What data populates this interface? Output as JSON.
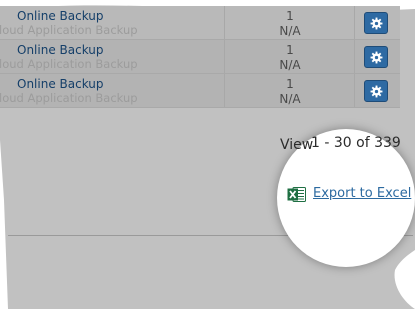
{
  "table": {
    "rows": [
      {
        "service": "Online Backup",
        "subtitle": "Cloud Application Backup",
        "quantity": "1",
        "price": "N/A"
      },
      {
        "service": "Online Backup",
        "subtitle": "Cloud Application Backup",
        "quantity": "1",
        "price": "N/A"
      },
      {
        "service": "Online Backup",
        "subtitle": "Cloud Application Backup",
        "quantity": "1",
        "price": "N/A"
      }
    ]
  },
  "pagination": {
    "view_prefix": "View",
    "range_text": "1 - 30 of 339"
  },
  "export": {
    "label": "Export to Excel",
    "icon": "excel-icon"
  },
  "icons": {
    "row_action": "gear-icon"
  },
  "colors": {
    "link": "#2c6aa0",
    "service_name": "#153f69",
    "gear_button": "#2e6aa3",
    "excel_green": "#1f6f43"
  }
}
